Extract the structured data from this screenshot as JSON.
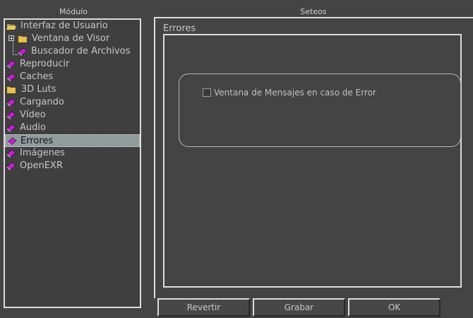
{
  "left_panel": {
    "title": "Módulo",
    "tree": [
      {
        "label": "Interfaz de Usuario",
        "icon": "open-folder-icon",
        "selected": false
      },
      {
        "label": "Ventana de Visor",
        "icon": "folder-icon",
        "selected": false
      },
      {
        "label": "Buscador de Archivos",
        "icon": "book-icon",
        "selected": false
      },
      {
        "label": "Reproducir",
        "icon": "book-icon",
        "selected": false
      },
      {
        "label": "Caches",
        "icon": "book-icon",
        "selected": false
      },
      {
        "label": "3D Luts",
        "icon": "folder-icon",
        "selected": false
      },
      {
        "label": "Cargando",
        "icon": "book-icon",
        "selected": false
      },
      {
        "label": "Vídeo",
        "icon": "book-icon",
        "selected": false
      },
      {
        "label": "Audio",
        "icon": "book-icon",
        "selected": false
      },
      {
        "label": "Errores",
        "icon": "book-icon",
        "selected": true
      },
      {
        "label": "Imágenes",
        "icon": "book-icon",
        "selected": false
      },
      {
        "label": "OpenEXR",
        "icon": "book-icon",
        "selected": false
      }
    ]
  },
  "right_panel": {
    "title": "Seteos",
    "group_title": "Errores",
    "checkbox": {
      "label": "Ventana de Mensajes en caso de Error",
      "checked": false
    }
  },
  "buttons": {
    "revert": "Revertir",
    "save": "Grabar",
    "ok": "OK"
  },
  "colors": {
    "background": "#444444",
    "book": "#c71fd3",
    "folder": "#e8c04a",
    "selected_row": "#8f9b9d"
  }
}
